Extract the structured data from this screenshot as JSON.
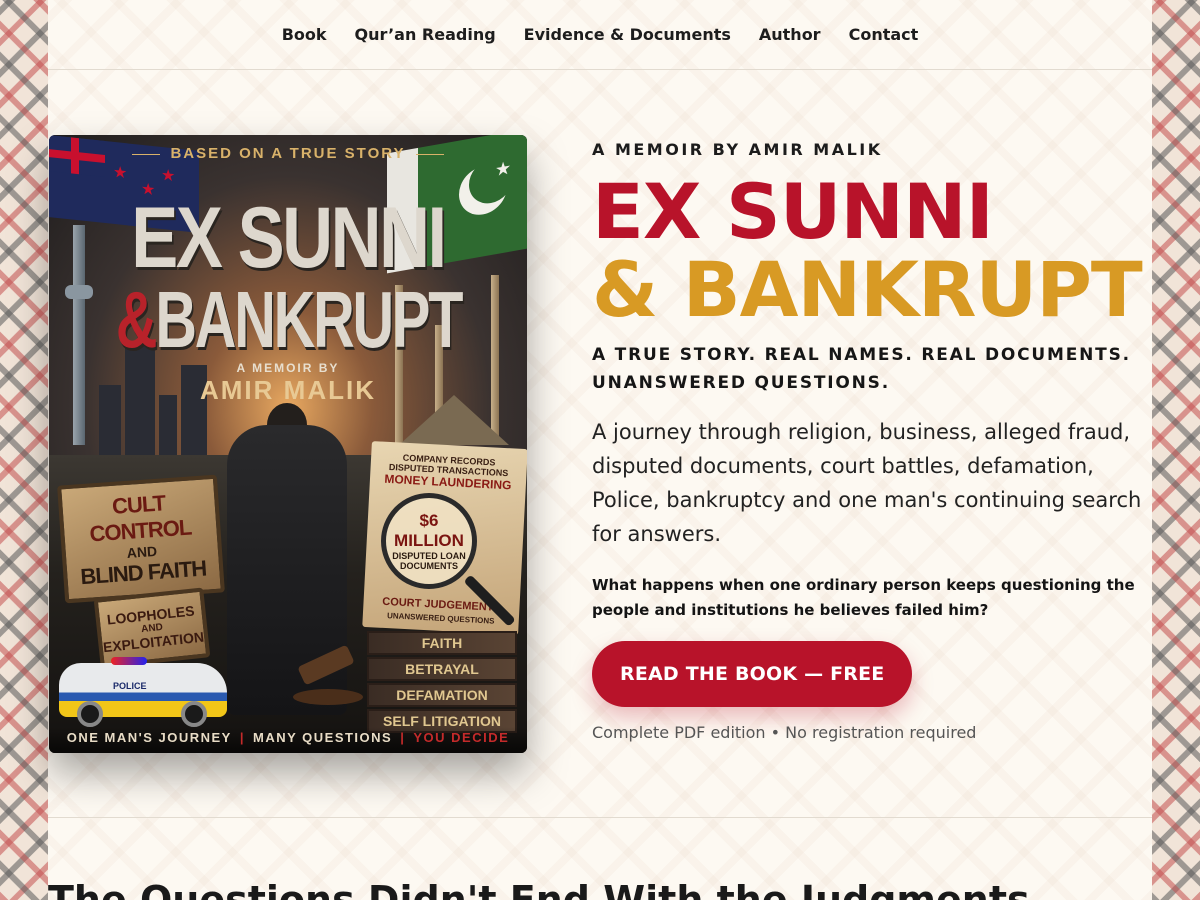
{
  "nav": {
    "items": [
      "Book",
      "Qur’an Reading",
      "Evidence & Documents",
      "Author",
      "Contact"
    ]
  },
  "cover": {
    "tagline": "BASED ON A TRUE STORY",
    "title_line1": "EX SUNNI",
    "title_amp": "&",
    "title_line2": "BANKRUPT",
    "memoir_by": "A MEMOIR BY",
    "author": "AMIR MALIK",
    "sign_cult": [
      "CULT CONTROL",
      "AND",
      "BLIND FAITH"
    ],
    "sign_loopholes": [
      "LOOPHOLES",
      "AND",
      "EXPLOITATION"
    ],
    "paper_lines": [
      "COMPANY RECORDS",
      "DISPUTED TRANSACTIONS",
      "MONEY LAUNDERING"
    ],
    "magnifier": [
      "$6 MILLION",
      "DISPUTED LOAN",
      "DOCUMENTS"
    ],
    "paper_bottom": [
      "COURT JUDGEMENTS",
      "UNANSWERED QUESTIONS"
    ],
    "books": [
      "FAITH",
      "BETRAYAL",
      "DEFAMATION",
      "SELF LITIGATION"
    ],
    "police_label": "POLICE",
    "footer": [
      "ONE MAN'S JOURNEY",
      "MANY QUESTIONS",
      "YOU DECIDE"
    ]
  },
  "hero": {
    "eyebrow": "A MEMOIR BY AMIR MALIK",
    "title_line1": "EX SUNNI",
    "title_line2": "& BANKRUPT",
    "subhead": "A TRUE STORY. REAL NAMES. REAL DOCUMENTS. UNANSWERED QUESTIONS.",
    "lede": "A journey through religion, business, alleged fraud, disputed documents, court battles, defamation, Police, bankruptcy and one man's continuing search for answers.",
    "question": "What happens when one ordinary person keeps questioning the people and institutions he believes failed him?",
    "cta_label": "READ THE BOOK — FREE",
    "cta_note": "Complete PDF edition • No registration required"
  },
  "next_section": {
    "title": "The Questions Didn't End With the Judgments"
  },
  "colors": {
    "accent_red": "#b8132a",
    "accent_gold": "#d89a24"
  }
}
